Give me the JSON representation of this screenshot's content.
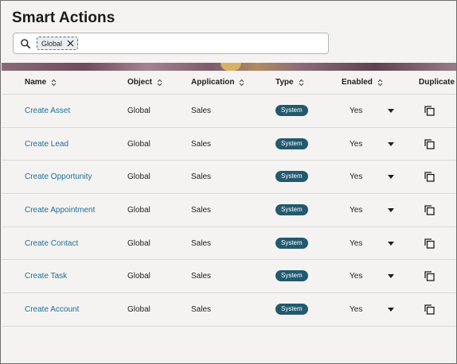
{
  "page": {
    "title": "Smart Actions"
  },
  "search": {
    "chip_label": "Global"
  },
  "columns": [
    {
      "label": "Name",
      "sortable": true
    },
    {
      "label": "Object",
      "sortable": true
    },
    {
      "label": "Application",
      "sortable": true
    },
    {
      "label": "Type",
      "sortable": true
    },
    {
      "label": "Enabled",
      "sortable": true
    },
    {
      "label": "Duplicate",
      "sortable": false
    }
  ],
  "rows": [
    {
      "name": "Create Asset",
      "object": "Global",
      "application": "Sales",
      "type": "System",
      "enabled": "Yes"
    },
    {
      "name": "Create Lead",
      "object": "Global",
      "application": "Sales",
      "type": "System",
      "enabled": "Yes"
    },
    {
      "name": "Create Opportunity",
      "object": "Global",
      "application": "Sales",
      "type": "System",
      "enabled": "Yes"
    },
    {
      "name": "Create Appointment",
      "object": "Global",
      "application": "Sales",
      "type": "System",
      "enabled": "Yes"
    },
    {
      "name": "Create Contact",
      "object": "Global",
      "application": "Sales",
      "type": "System",
      "enabled": "Yes"
    },
    {
      "name": "Create Task",
      "object": "Global",
      "application": "Sales",
      "type": "System",
      "enabled": "Yes"
    },
    {
      "name": "Create Account",
      "object": "Global",
      "application": "Sales",
      "type": "System",
      "enabled": "Yes"
    }
  ],
  "icons": {
    "search": "search-icon",
    "chip_remove": "close-icon",
    "sort": "sort-icon",
    "enabled_menu": "caret-down-icon",
    "duplicate": "duplicate-icon"
  },
  "colors": {
    "link": "#1f6f94",
    "badge": "#22596e",
    "background": "#f4f3f1"
  }
}
